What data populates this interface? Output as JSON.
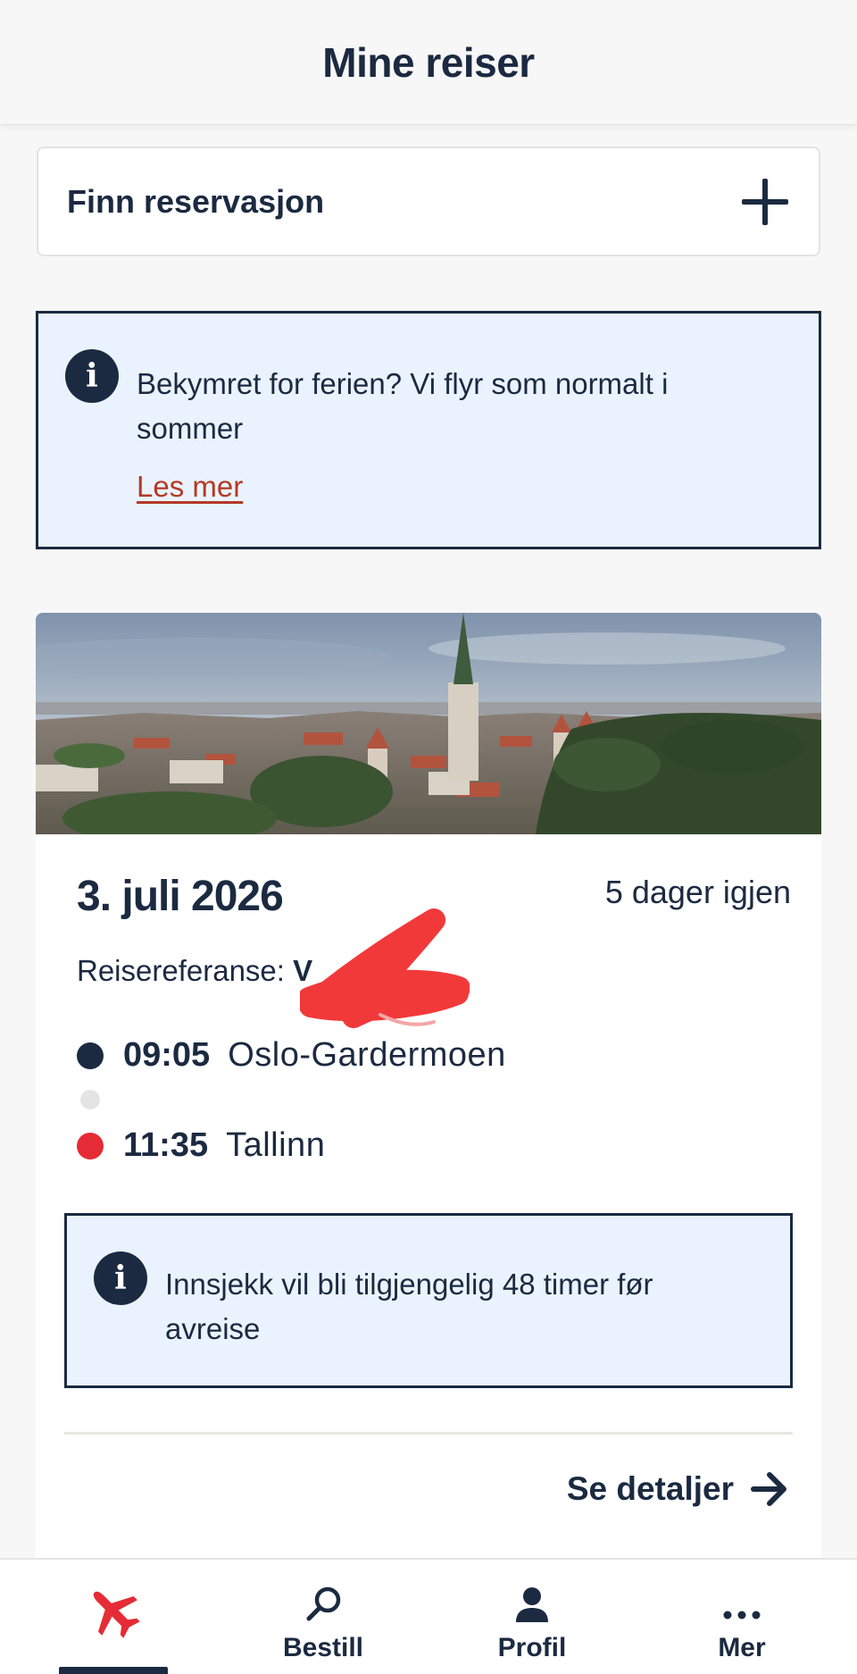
{
  "header": {
    "title": "Mine reiser"
  },
  "find_reservation": {
    "label": "Finn reservasjon",
    "icon": "plus-icon"
  },
  "notice": {
    "text": "Bekymret for ferien? Vi flyr som normalt i sommer",
    "link": "Les mer",
    "icon": "info-icon"
  },
  "trip": {
    "date": "3. juli 2026",
    "countdown": "5 dager igjen",
    "reference_label": "Reisereferanse:",
    "reference_value": "V",
    "segments": [
      {
        "time": "09:05",
        "place": "Oslo-Gardermoen",
        "dot_color": "#1b2a41"
      },
      {
        "time": "11:35",
        "place": "Tallinn",
        "dot_color": "#e52b35"
      }
    ],
    "checkin_notice": "Innsjekk vil bli tilgjengelig 48 timer før avreise",
    "details_link": "Se detaljer"
  },
  "bottom_nav": {
    "items": [
      {
        "label": "",
        "icon": "plane-icon",
        "active": true
      },
      {
        "label": "Bestill",
        "icon": "search-icon",
        "active": false
      },
      {
        "label": "Profil",
        "icon": "person-icon",
        "active": false
      },
      {
        "label": "Mer",
        "icon": "more-icon",
        "active": false
      }
    ]
  },
  "colors": {
    "navy": "#1b2a41",
    "brand_red": "#e52b35",
    "link_red": "#b33a26",
    "info_bg": "#eaf3fd",
    "page_bg": "#f7f7f7"
  }
}
